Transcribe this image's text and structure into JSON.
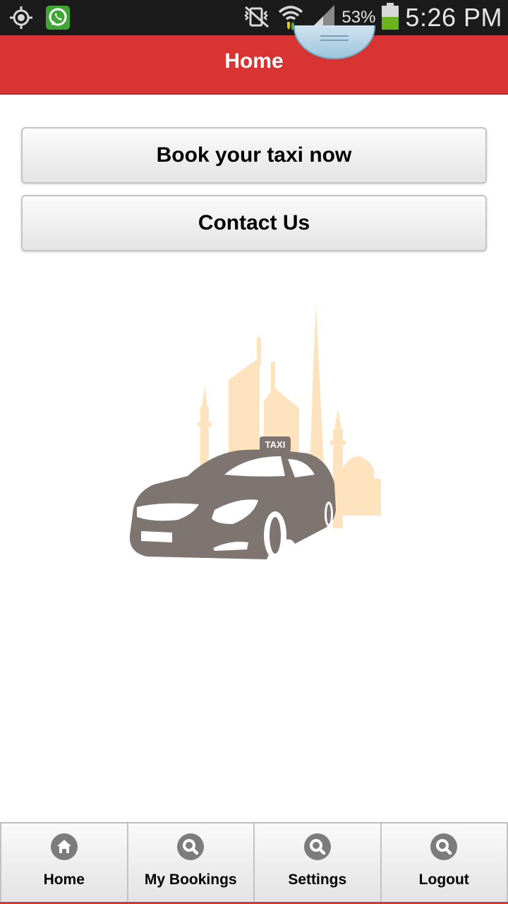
{
  "status_bar": {
    "battery_percent": "53%",
    "time": "5:26 PM",
    "icons": [
      "gps-icon",
      "whatsapp-icon",
      "vibrate-icon",
      "wifi-icon",
      "signal-icon",
      "battery-icon"
    ]
  },
  "header": {
    "title": "Home",
    "color": "#d93434"
  },
  "actions": {
    "book_label": "Book your taxi now",
    "contact_label": "Contact Us"
  },
  "illustration": {
    "taxi_sign": "TAXI",
    "car_color": "#7f7570",
    "skyline_color": "#fde4bf"
  },
  "bottom_nav": {
    "items": [
      {
        "label": "Home",
        "icon": "home-icon"
      },
      {
        "label": "My Bookings",
        "icon": "search-icon"
      },
      {
        "label": "Settings",
        "icon": "search-icon"
      },
      {
        "label": "Logout",
        "icon": "search-icon"
      }
    ]
  }
}
